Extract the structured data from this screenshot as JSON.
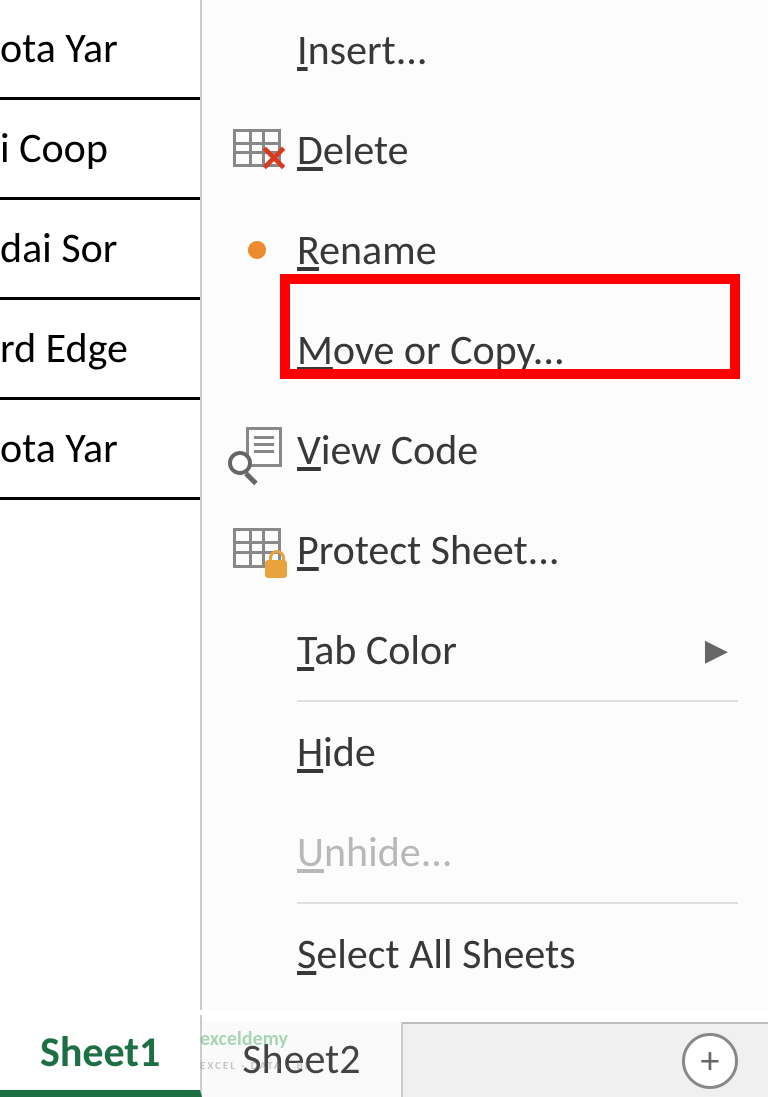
{
  "cells": {
    "r1": "ota Yar",
    "r2": "i Coop",
    "r3": "dai Sor",
    "r4": "rd Edge",
    "r5": "ota Yar"
  },
  "menu": {
    "insert": "nsert...",
    "insert_ul": "I",
    "delete": "elete",
    "delete_ul": "D",
    "rename": "ename",
    "rename_ul": "R",
    "move_or_copy": "ove or Copy...",
    "move_or_copy_ul": "M",
    "view_code": "iew Code",
    "view_code_ul": "V",
    "protect_sheet": "rotect Sheet...",
    "protect_sheet_ul": "P",
    "tab_color": "ab Color",
    "tab_color_ul": "T",
    "hide": "ide",
    "hide_ul": "H",
    "unhide": "nhide...",
    "unhide_ul": "U",
    "select_all": "elect All Sheets",
    "select_all_ul": "S"
  },
  "tabs": {
    "active": "Sheet1",
    "second": "Sheet2"
  },
  "watermark": {
    "main": "exceldemy",
    "sub": "EXCEL · DATA · BI"
  }
}
